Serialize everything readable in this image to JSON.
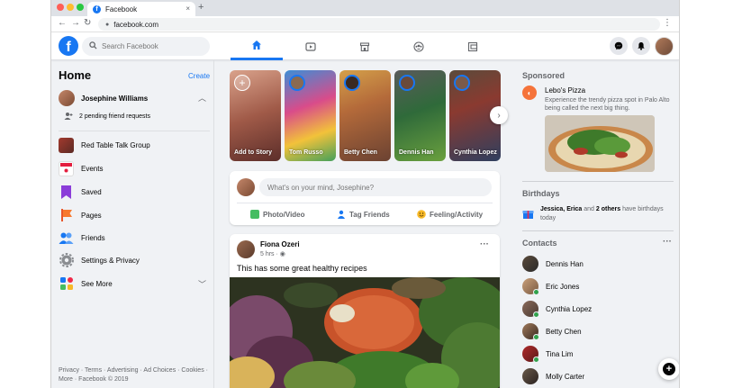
{
  "browser": {
    "tab_title": "Facebook",
    "tab_close": "×",
    "new_tab": "+",
    "url": "facebook.com",
    "nav_back": "←",
    "nav_forward": "→",
    "nav_reload": "↻",
    "menu": "⋮"
  },
  "fb_nav": {
    "logo": "f",
    "search_placeholder": "Search Facebook",
    "tabs": [
      "home",
      "watch",
      "marketplace",
      "groups",
      "gaming"
    ],
    "active_tab": "home",
    "accent": "#1877f2"
  },
  "left": {
    "title": "Home",
    "create": "Create",
    "profile_name": "Josephine Williams",
    "pending": "2 pending friend requests",
    "items": [
      {
        "label": "Red Table Talk Group",
        "icon": "group-photo-icon"
      },
      {
        "label": "Events",
        "icon": "calendar-icon"
      },
      {
        "label": "Saved",
        "icon": "bookmark-icon"
      },
      {
        "label": "Pages",
        "icon": "flag-icon"
      },
      {
        "label": "Friends",
        "icon": "friends-icon"
      },
      {
        "label": "Settings & Privacy",
        "icon": "gear-icon"
      },
      {
        "label": "See More",
        "icon": "apps-icon"
      }
    ],
    "footer": "Privacy · Terms · Advertising · Ad Choices · Cookies · More · Facebook © 2019"
  },
  "stories": [
    {
      "name": "Add to Story"
    },
    {
      "name": "Tom Russo"
    },
    {
      "name": "Betty Chen"
    },
    {
      "name": "Dennis Han"
    },
    {
      "name": "Cynthia Lopez"
    }
  ],
  "composer": {
    "placeholder": "What's on your mind, Josephine?",
    "photo_video": "Photo/Video",
    "tag_friends": "Tag Friends",
    "feeling": "Feeling/Activity"
  },
  "post": {
    "author": "Fiona Ozeri",
    "time": "5 hrs · ",
    "privacy_icon": "globe-icon",
    "text": "This has some great healthy recipes",
    "menu": "···"
  },
  "right": {
    "sponsored": "Sponsored",
    "ad_title": "Lebo's Pizza",
    "ad_desc": "Experience the trendy pizza spot in Palo Alto being called the next big thing.",
    "birthdays": "Birthdays",
    "birthday_names": "Jessica, Erica",
    "birthday_and": " and ",
    "birthday_others": "2 others",
    "birthday_rest": " have birthdays today",
    "contacts": "Contacts",
    "contacts_menu": "···",
    "contact_list": [
      {
        "name": "Dennis Han",
        "online": false
      },
      {
        "name": "Eric Jones",
        "online": true
      },
      {
        "name": "Cynthia Lopez",
        "online": true
      },
      {
        "name": "Betty Chen",
        "online": true
      },
      {
        "name": "Tina Lim",
        "online": true
      },
      {
        "name": "Molly Carter",
        "online": false
      }
    ],
    "new_message": "+"
  }
}
